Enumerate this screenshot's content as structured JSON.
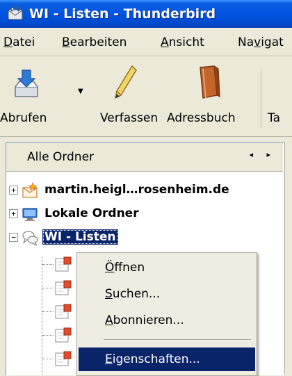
{
  "window": {
    "title": "WI - Listen - Thunderbird",
    "icon": "thunderbird-icon"
  },
  "menubar": {
    "items": [
      {
        "pre": "",
        "key": "D",
        "post": "atei"
      },
      {
        "pre": "",
        "key": "B",
        "post": "earbeiten"
      },
      {
        "pre": "",
        "key": "A",
        "post": "nsicht"
      },
      {
        "pre": "Na",
        "key": "v",
        "post": "igat"
      }
    ]
  },
  "toolbar": {
    "get_label": "Abrufen",
    "compose_label": "Verfassen",
    "addressbook_label": "Adressbuch",
    "tag_label": "Ta"
  },
  "folder_pane": {
    "header": "Alle Ordner",
    "nav_arrows": "◂ ▸",
    "accounts": [
      {
        "label": "martin.heigl…rosenheim.de",
        "expander": "+",
        "icon": "mail-account-icon",
        "selected": false
      },
      {
        "label": "Lokale Ordner",
        "expander": "+",
        "icon": "local-folders-icon",
        "selected": false
      },
      {
        "label": "WI - Listen",
        "expander": "−",
        "icon": "newsgroup-account-icon",
        "selected": true
      }
    ]
  },
  "context_menu": {
    "items": [
      {
        "pre": "",
        "key": "Ö",
        "post": "ffnen"
      },
      {
        "pre": "",
        "key": "S",
        "post": "uchen..."
      },
      {
        "pre": "",
        "key": "A",
        "post": "bonnieren..."
      },
      {
        "pre": "",
        "key": "E",
        "post": "igenschaften..."
      }
    ]
  },
  "colors": {
    "selection": "#0a246a",
    "titlebar": "#0054e3",
    "menu_bg": "#efede2"
  }
}
